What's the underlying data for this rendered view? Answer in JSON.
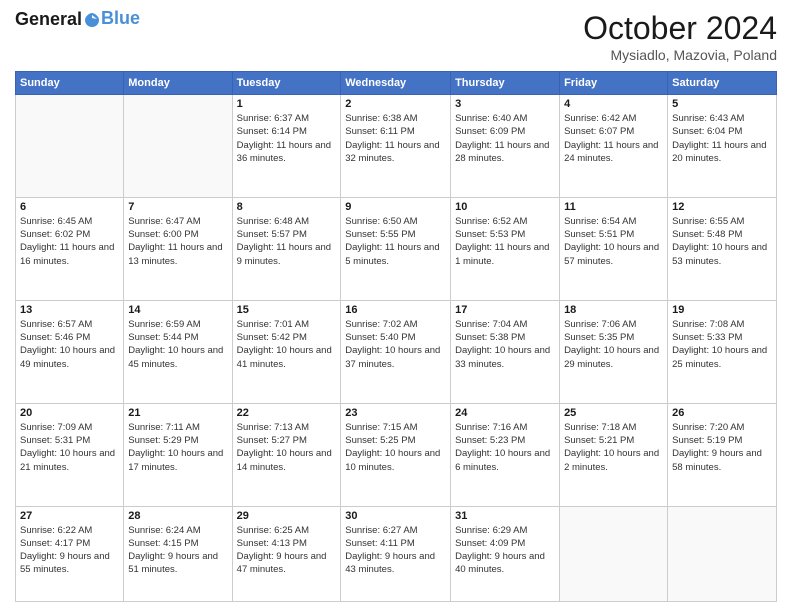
{
  "header": {
    "logo_line1": "General",
    "logo_line2": "Blue",
    "month": "October 2024",
    "location": "Mysiadlo, Mazovia, Poland"
  },
  "weekdays": [
    "Sunday",
    "Monday",
    "Tuesday",
    "Wednesday",
    "Thursday",
    "Friday",
    "Saturday"
  ],
  "weeks": [
    [
      {
        "day": "",
        "detail": ""
      },
      {
        "day": "",
        "detail": ""
      },
      {
        "day": "1",
        "detail": "Sunrise: 6:37 AM\nSunset: 6:14 PM\nDaylight: 11 hours and 36 minutes."
      },
      {
        "day": "2",
        "detail": "Sunrise: 6:38 AM\nSunset: 6:11 PM\nDaylight: 11 hours and 32 minutes."
      },
      {
        "day": "3",
        "detail": "Sunrise: 6:40 AM\nSunset: 6:09 PM\nDaylight: 11 hours and 28 minutes."
      },
      {
        "day": "4",
        "detail": "Sunrise: 6:42 AM\nSunset: 6:07 PM\nDaylight: 11 hours and 24 minutes."
      },
      {
        "day": "5",
        "detail": "Sunrise: 6:43 AM\nSunset: 6:04 PM\nDaylight: 11 hours and 20 minutes."
      }
    ],
    [
      {
        "day": "6",
        "detail": "Sunrise: 6:45 AM\nSunset: 6:02 PM\nDaylight: 11 hours and 16 minutes."
      },
      {
        "day": "7",
        "detail": "Sunrise: 6:47 AM\nSunset: 6:00 PM\nDaylight: 11 hours and 13 minutes."
      },
      {
        "day": "8",
        "detail": "Sunrise: 6:48 AM\nSunset: 5:57 PM\nDaylight: 11 hours and 9 minutes."
      },
      {
        "day": "9",
        "detail": "Sunrise: 6:50 AM\nSunset: 5:55 PM\nDaylight: 11 hours and 5 minutes."
      },
      {
        "day": "10",
        "detail": "Sunrise: 6:52 AM\nSunset: 5:53 PM\nDaylight: 11 hours and 1 minute."
      },
      {
        "day": "11",
        "detail": "Sunrise: 6:54 AM\nSunset: 5:51 PM\nDaylight: 10 hours and 57 minutes."
      },
      {
        "day": "12",
        "detail": "Sunrise: 6:55 AM\nSunset: 5:48 PM\nDaylight: 10 hours and 53 minutes."
      }
    ],
    [
      {
        "day": "13",
        "detail": "Sunrise: 6:57 AM\nSunset: 5:46 PM\nDaylight: 10 hours and 49 minutes."
      },
      {
        "day": "14",
        "detail": "Sunrise: 6:59 AM\nSunset: 5:44 PM\nDaylight: 10 hours and 45 minutes."
      },
      {
        "day": "15",
        "detail": "Sunrise: 7:01 AM\nSunset: 5:42 PM\nDaylight: 10 hours and 41 minutes."
      },
      {
        "day": "16",
        "detail": "Sunrise: 7:02 AM\nSunset: 5:40 PM\nDaylight: 10 hours and 37 minutes."
      },
      {
        "day": "17",
        "detail": "Sunrise: 7:04 AM\nSunset: 5:38 PM\nDaylight: 10 hours and 33 minutes."
      },
      {
        "day": "18",
        "detail": "Sunrise: 7:06 AM\nSunset: 5:35 PM\nDaylight: 10 hours and 29 minutes."
      },
      {
        "day": "19",
        "detail": "Sunrise: 7:08 AM\nSunset: 5:33 PM\nDaylight: 10 hours and 25 minutes."
      }
    ],
    [
      {
        "day": "20",
        "detail": "Sunrise: 7:09 AM\nSunset: 5:31 PM\nDaylight: 10 hours and 21 minutes."
      },
      {
        "day": "21",
        "detail": "Sunrise: 7:11 AM\nSunset: 5:29 PM\nDaylight: 10 hours and 17 minutes."
      },
      {
        "day": "22",
        "detail": "Sunrise: 7:13 AM\nSunset: 5:27 PM\nDaylight: 10 hours and 14 minutes."
      },
      {
        "day": "23",
        "detail": "Sunrise: 7:15 AM\nSunset: 5:25 PM\nDaylight: 10 hours and 10 minutes."
      },
      {
        "day": "24",
        "detail": "Sunrise: 7:16 AM\nSunset: 5:23 PM\nDaylight: 10 hours and 6 minutes."
      },
      {
        "day": "25",
        "detail": "Sunrise: 7:18 AM\nSunset: 5:21 PM\nDaylight: 10 hours and 2 minutes."
      },
      {
        "day": "26",
        "detail": "Sunrise: 7:20 AM\nSunset: 5:19 PM\nDaylight: 9 hours and 58 minutes."
      }
    ],
    [
      {
        "day": "27",
        "detail": "Sunrise: 6:22 AM\nSunset: 4:17 PM\nDaylight: 9 hours and 55 minutes."
      },
      {
        "day": "28",
        "detail": "Sunrise: 6:24 AM\nSunset: 4:15 PM\nDaylight: 9 hours and 51 minutes."
      },
      {
        "day": "29",
        "detail": "Sunrise: 6:25 AM\nSunset: 4:13 PM\nDaylight: 9 hours and 47 minutes."
      },
      {
        "day": "30",
        "detail": "Sunrise: 6:27 AM\nSunset: 4:11 PM\nDaylight: 9 hours and 43 minutes."
      },
      {
        "day": "31",
        "detail": "Sunrise: 6:29 AM\nSunset: 4:09 PM\nDaylight: 9 hours and 40 minutes."
      },
      {
        "day": "",
        "detail": ""
      },
      {
        "day": "",
        "detail": ""
      }
    ]
  ]
}
